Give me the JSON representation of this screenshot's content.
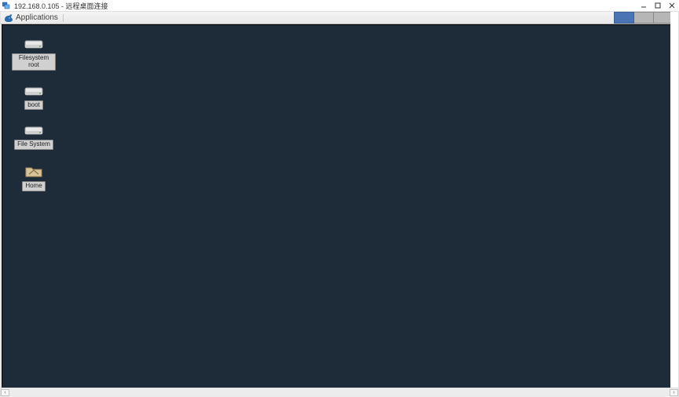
{
  "window": {
    "title": "192.168.0.105 - 远程桌面连接",
    "controls": {
      "minimize": "minimize",
      "maximize": "maximize",
      "close": "close"
    }
  },
  "panel": {
    "applications_label": "Applications",
    "tray": {
      "box1": "workspace-1",
      "box2": "workspace-2",
      "box3": "workspace-3"
    }
  },
  "desktop": {
    "background_color": "#1e2b38",
    "icons": [
      {
        "id": "filesystem-root",
        "type": "drive",
        "label": "Filesystem root"
      },
      {
        "id": "boot",
        "type": "drive",
        "label": "boot"
      },
      {
        "id": "file-system",
        "type": "drive",
        "label": "File System"
      },
      {
        "id": "home",
        "type": "folder",
        "label": "Home"
      }
    ]
  },
  "scrollbar": {
    "left_arrow": "‹",
    "right_arrow": "›"
  }
}
